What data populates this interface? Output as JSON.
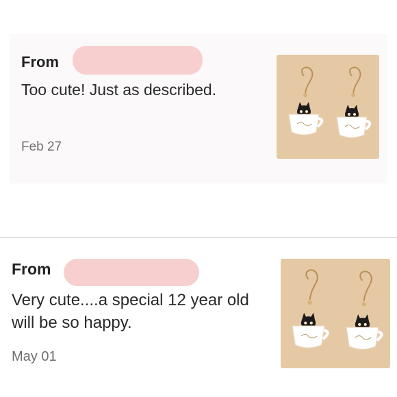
{
  "reviews": [
    {
      "from_label": "From",
      "text": "Too cute! Just as described.",
      "date": "Feb 27",
      "image_icon": "cat-in-coffee-cup-earrings-photo"
    },
    {
      "from_label": "From",
      "text": "Very cute....a special 12 year old will be so happy.",
      "date": "May 01",
      "image_icon": "cat-in-coffee-cup-earrings-photo"
    }
  ],
  "colors": {
    "redaction": "#f7cfcf",
    "photo_background": "#e5c9a4",
    "card_background": "#fbf9fa",
    "divider": "#e2e2e2"
  }
}
